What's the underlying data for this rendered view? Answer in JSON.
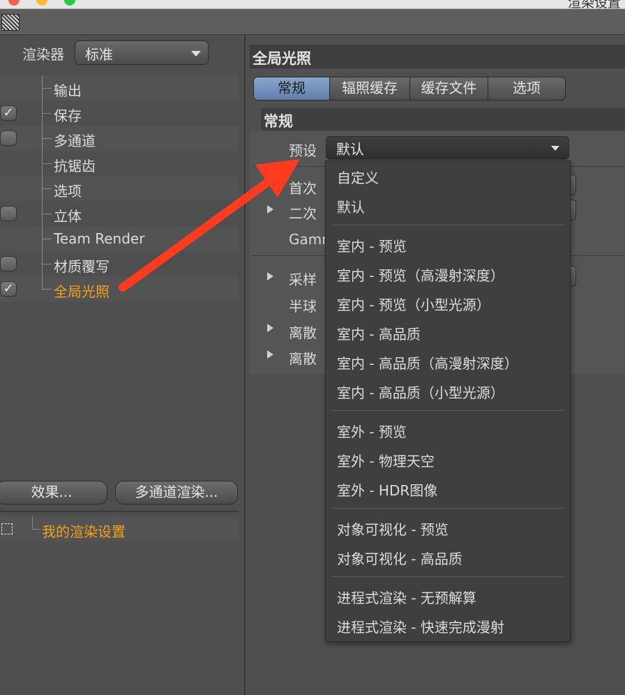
{
  "window": {
    "title": "渲染设置"
  },
  "colors": {
    "accent_orange": "#f4a21a",
    "tab_selected": "#7393bd",
    "arrow_red": "#ff3b1f"
  },
  "left": {
    "renderer_label": "渲染器",
    "renderer_value": "标准",
    "tree": [
      {
        "label": "输出",
        "checkbox": "none"
      },
      {
        "label": "保存",
        "checkbox": "checked"
      },
      {
        "label": "多通道",
        "checkbox": "unchecked"
      },
      {
        "label": "抗锯齿",
        "checkbox": "none"
      },
      {
        "label": "选项",
        "checkbox": "none"
      },
      {
        "label": "立体",
        "checkbox": "unchecked"
      },
      {
        "label": "Team Render",
        "checkbox": "none"
      },
      {
        "label": "材质覆写",
        "checkbox": "unchecked"
      },
      {
        "label": "全局光照",
        "checkbox": "checked",
        "active": true
      }
    ],
    "effects_button": "效果...",
    "multipass_button": "多通道渲染...",
    "my_render_setting": "我的渲染设置"
  },
  "right": {
    "header": "全局光照",
    "tabs": [
      "常规",
      "辐照缓存",
      "缓存文件",
      "选项"
    ],
    "selected_tab": "常规",
    "section_title": "常规",
    "preset_label": "预设",
    "preset_value": "默认",
    "param_labels": [
      "首次",
      "二次",
      "Gamm",
      "采样",
      "半球",
      "离散",
      "离散"
    ]
  },
  "menu": {
    "groups": [
      [
        "自定义",
        "默认"
      ],
      [
        "室内 - 预览",
        "室内 - 预览（高漫射深度）",
        "室内 - 预览（小型光源）",
        "室内 - 高品质",
        "室内 - 高品质（高漫射深度）",
        "室内 - 高品质（小型光源）"
      ],
      [
        "室外 - 预览",
        "室外 - 物理天空",
        "室外 - HDR图像"
      ],
      [
        "对象可视化 - 预览",
        "对象可视化 - 高品质"
      ],
      [
        "进程式渲染 - 无预解算",
        "进程式渲染 - 快速完成漫射"
      ]
    ]
  }
}
